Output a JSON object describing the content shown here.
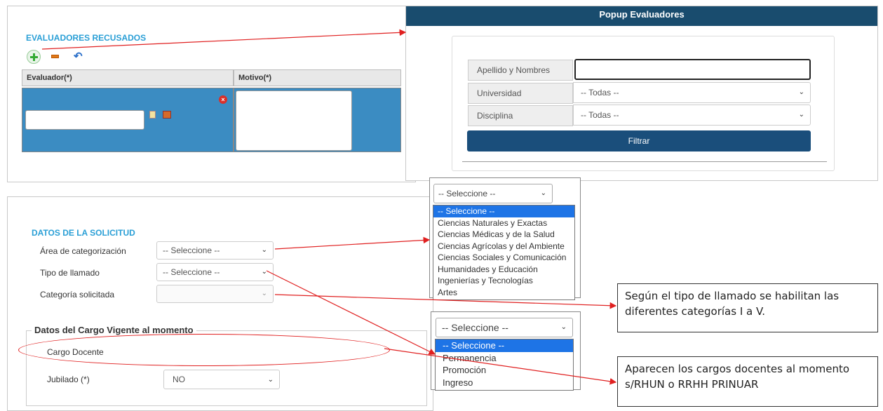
{
  "recusados": {
    "title": "EVALUADORES RECUSADOS",
    "col_evaluador": "Evaluador(*)",
    "col_motivo": "Motivo(*)"
  },
  "popup": {
    "title": "Popup Evaluadores",
    "apellido_label": "Apellido y Nombres",
    "apellido_value": "",
    "universidad_label": "Universidad",
    "universidad_value": "-- Todas --",
    "disciplina_label": "Disciplina",
    "disciplina_value": "-- Todas --",
    "filter_label": "Filtrar"
  },
  "solicitud": {
    "title": "DATOS DE LA SOLICITUD",
    "area_label": "Área de categorización",
    "area_value": "-- Seleccione --",
    "tipo_label": "Tipo de llamado",
    "tipo_value": "-- Seleccione --",
    "categoria_label": "Categoría solicitada",
    "categoria_value": "",
    "cargo_section_title": "Datos del Cargo Vigente al momento",
    "cargo_docente_label": "Cargo Docente",
    "jubilado_label": "Jubilado (*)",
    "jubilado_value": "NO"
  },
  "area_dropdown": {
    "selected": "-- Seleccione --",
    "options": [
      "-- Seleccione --",
      "Ciencias Naturales y Exactas",
      "Ciencias Médicas y de la Salud",
      "Ciencias Agrícolas y del Ambiente",
      "Ciencias Sociales y Comunicación",
      "Humanidades y Educación",
      "Ingenierías y Tecnologías",
      "Artes"
    ]
  },
  "tipo_dropdown": {
    "selected": "-- Seleccione --",
    "options": [
      "-- Seleccione --",
      "Permanencia",
      "Promoción",
      "Ingreso"
    ]
  },
  "callouts": {
    "categorias": "Según el tipo de llamado se habilitan las diferentes categorías I a V.",
    "cargos": "Aparecen los cargos docentes al momento s/RHUN o RRHH PRINUAR"
  },
  "colors": {
    "popup_header": "#194c6e",
    "filter_button": "#1a4e7b",
    "section_title": "#2a9fd6",
    "table_body": "#3b8cc2",
    "selected_option": "#1e74e6",
    "arrow": "#e02020"
  }
}
